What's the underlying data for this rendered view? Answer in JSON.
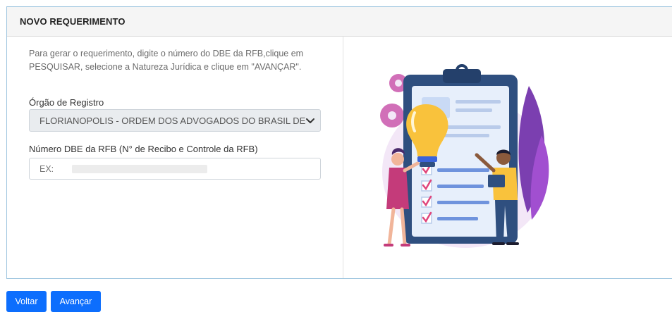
{
  "card": {
    "title": "NOVO REQUERIMENTO",
    "instructions": "Para gerar o requerimento, digite o número do DBE da RFB,clique em PESQUISAR, selecione a Natureza Jurídica e clique em \"AVANÇAR\"."
  },
  "form": {
    "orgao_label": "Órgão de Registro",
    "orgao_value": "FLORIANOPOLIS - ORDEM DOS ADVOGADOS DO BRASIL DE",
    "dbe_label": "Número DBE da RFB (N° de Recibo e Controle da RFB)",
    "dbe_value": "EX:"
  },
  "buttons": {
    "back": "Voltar",
    "next": "Avançar"
  },
  "illustration": {
    "icon": "clipboard-checklist-illustration",
    "colors": [
      "#7c5ce6",
      "#f9c23c",
      "#2f4f7f",
      "#e95a9b",
      "#3b63d9"
    ]
  },
  "theme": {
    "primary": "#0d6efd",
    "header_bg": "#f5f5f5",
    "border": "#9ec5df"
  }
}
